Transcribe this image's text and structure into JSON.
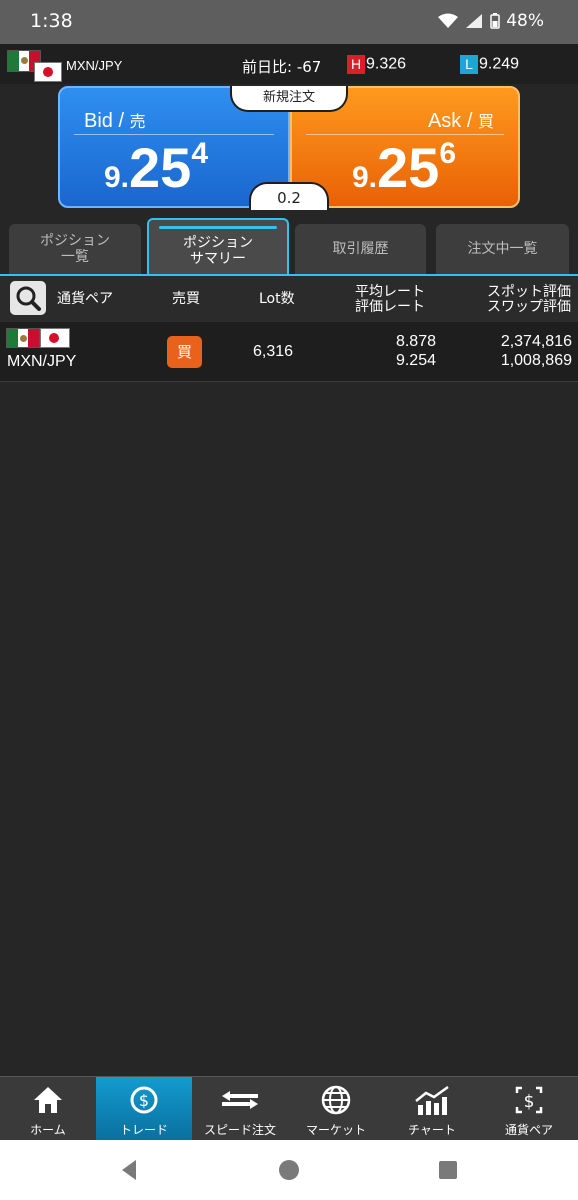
{
  "status_bar": {
    "time": "1:38",
    "battery": "48%"
  },
  "rate_header": {
    "pair": "MXN/JPY",
    "prev_diff": "前日比: -67",
    "high_badge": "H",
    "high_value": "9.326",
    "low_badge": "L",
    "low_value": "9.249",
    "high_color": "#d91f2a",
    "low_color": "#1aa6d6"
  },
  "quote": {
    "new_order": "新規注文",
    "bid": {
      "label": "Bid",
      "sub": "売",
      "prefix": "9.",
      "main": "25",
      "pip": "4"
    },
    "ask": {
      "label": "Ask",
      "sub": "買",
      "prefix": "9.",
      "main": "25",
      "pip": "6"
    },
    "spread": "0.2"
  },
  "tabs": [
    {
      "line1": "ポジション",
      "line2": "一覧"
    },
    {
      "line1": "ポジション",
      "line2": "サマリー"
    },
    {
      "line1": "取引履歴",
      "line2": ""
    },
    {
      "line1": "注文中一覧",
      "line2": ""
    }
  ],
  "table": {
    "headers": {
      "pair": "通貨ペア",
      "side": "売買",
      "lots": "Lot数",
      "rate_line1": "平均レート",
      "rate_line2": "評価レート",
      "eval_line1": "スポット評価",
      "eval_line2": "スワップ評価"
    },
    "rows": [
      {
        "pair": "MXN/JPY",
        "side": "買",
        "lots": "6,316",
        "avg_rate": "8.878",
        "eval_rate": "9.254",
        "spot_eval": "2,374,816",
        "swap_eval": "1,008,869"
      }
    ]
  },
  "bottom_nav": [
    {
      "label": "ホーム",
      "icon": "home-icon"
    },
    {
      "label": "トレード",
      "icon": "trade-icon"
    },
    {
      "label": "スピード注文",
      "icon": "speed-order-icon"
    },
    {
      "label": "マーケット",
      "icon": "globe-icon"
    },
    {
      "label": "チャート",
      "icon": "chart-icon"
    },
    {
      "label": "通貨ペア",
      "icon": "currency-pair-icon"
    }
  ],
  "colors": {
    "accent": "#33c1f0",
    "bid": "#1a66cf",
    "ask": "#e96106",
    "buy_badge": "#e8621c"
  }
}
